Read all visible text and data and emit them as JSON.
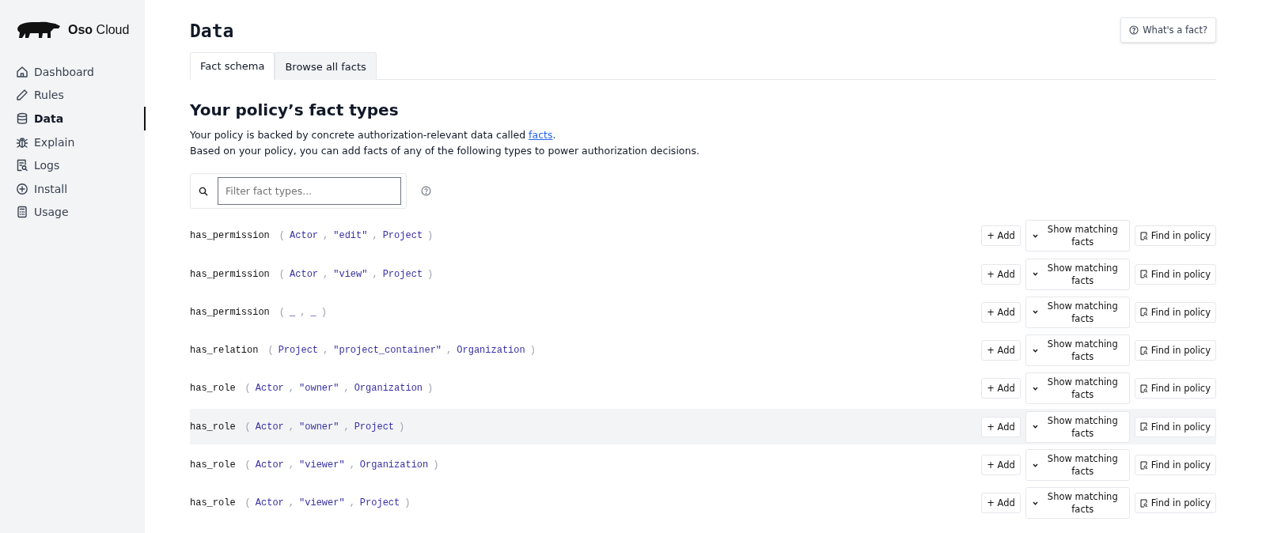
{
  "brand": {
    "name_bold": "Oso",
    "name_rest": "Cloud"
  },
  "sidebar": {
    "items": [
      {
        "label": "Dashboard",
        "selected": false
      },
      {
        "label": "Rules",
        "selected": false
      },
      {
        "label": "Data",
        "selected": true
      },
      {
        "label": "Explain",
        "selected": false
      },
      {
        "label": "Logs",
        "selected": false
      },
      {
        "label": "Install",
        "selected": false
      },
      {
        "label": "Usage",
        "selected": false
      }
    ]
  },
  "page": {
    "title": "Data",
    "help_button": "What's a fact?"
  },
  "tabs": [
    {
      "label": "Fact schema",
      "selected": true
    },
    {
      "label": "Browse all facts",
      "selected": false
    }
  ],
  "section": {
    "heading": "Your policy’s fact types",
    "intro_before_link": "Your policy is backed by concrete authorization-relevant data called",
    "intro_link": "facts",
    "intro_after_link": ".",
    "intro_line_2": "Based on your policy, you can add facts of any of the following types to power authorization decisions."
  },
  "filter": {
    "placeholder": "Filter fact types..."
  },
  "fact_types": [
    {
      "highlighted": false,
      "add": "+ Add",
      "show": "Show matching facts",
      "find": "Find in policy",
      "tokens": [
        {
          "kind": "name",
          "text": "has_permission"
        },
        {
          "kind": "punct",
          "text": "("
        },
        {
          "kind": "arg",
          "text": "Actor"
        },
        {
          "kind": "punct",
          "text": ","
        },
        {
          "kind": "arg",
          "text": "\"edit\""
        },
        {
          "kind": "punct",
          "text": ","
        },
        {
          "kind": "arg",
          "text": "Project"
        },
        {
          "kind": "punct",
          "text": ")"
        }
      ]
    },
    {
      "highlighted": false,
      "add": "+ Add",
      "show": "Show matching facts",
      "find": "Find in policy",
      "tokens": [
        {
          "kind": "name",
          "text": "has_permission"
        },
        {
          "kind": "punct",
          "text": "("
        },
        {
          "kind": "arg",
          "text": "Actor"
        },
        {
          "kind": "punct",
          "text": ","
        },
        {
          "kind": "arg",
          "text": "\"view\""
        },
        {
          "kind": "punct",
          "text": ","
        },
        {
          "kind": "arg",
          "text": "Project"
        },
        {
          "kind": "punct",
          "text": ")"
        }
      ]
    },
    {
      "highlighted": false,
      "add": "+ Add",
      "show": "Show matching facts",
      "find": "Find in policy",
      "tokens": [
        {
          "kind": "name",
          "text": "has_permission"
        },
        {
          "kind": "punct",
          "text": "("
        },
        {
          "kind": "arg",
          "text": "_"
        },
        {
          "kind": "punct",
          "text": ","
        },
        {
          "kind": "arg",
          "text": "_"
        },
        {
          "kind": "punct",
          "text": ")"
        }
      ]
    },
    {
      "highlighted": false,
      "add": "+ Add",
      "show": "Show matching facts",
      "find": "Find in policy",
      "tokens": [
        {
          "kind": "name",
          "text": "has_relation"
        },
        {
          "kind": "punct",
          "text": "("
        },
        {
          "kind": "arg",
          "text": "Project"
        },
        {
          "kind": "punct",
          "text": ","
        },
        {
          "kind": "arg",
          "text": "\"project_container\""
        },
        {
          "kind": "punct",
          "text": ","
        },
        {
          "kind": "arg",
          "text": "Organization"
        },
        {
          "kind": "punct",
          "text": ")"
        }
      ]
    },
    {
      "highlighted": false,
      "add": "+ Add",
      "show": "Show matching facts",
      "find": "Find in policy",
      "tokens": [
        {
          "kind": "name",
          "text": "has_role"
        },
        {
          "kind": "punct",
          "text": "("
        },
        {
          "kind": "arg",
          "text": "Actor"
        },
        {
          "kind": "punct",
          "text": ","
        },
        {
          "kind": "arg",
          "text": "\"owner\""
        },
        {
          "kind": "punct",
          "text": ","
        },
        {
          "kind": "arg",
          "text": "Organization"
        },
        {
          "kind": "punct",
          "text": ")"
        }
      ]
    },
    {
      "highlighted": true,
      "add": "+ Add",
      "show": "Show matching facts",
      "find": "Find in policy",
      "tokens": [
        {
          "kind": "name",
          "text": "has_role"
        },
        {
          "kind": "punct",
          "text": "("
        },
        {
          "kind": "arg",
          "text": "Actor"
        },
        {
          "kind": "punct",
          "text": ","
        },
        {
          "kind": "arg",
          "text": "\"owner\""
        },
        {
          "kind": "punct",
          "text": ","
        },
        {
          "kind": "arg",
          "text": "Project"
        },
        {
          "kind": "punct",
          "text": ")"
        }
      ]
    },
    {
      "highlighted": false,
      "add": "+ Add",
      "show": "Show matching facts",
      "find": "Find in policy",
      "tokens": [
        {
          "kind": "name",
          "text": "has_role"
        },
        {
          "kind": "punct",
          "text": "("
        },
        {
          "kind": "arg",
          "text": "Actor"
        },
        {
          "kind": "punct",
          "text": ","
        },
        {
          "kind": "arg",
          "text": "\"viewer\""
        },
        {
          "kind": "punct",
          "text": ","
        },
        {
          "kind": "arg",
          "text": "Organization"
        },
        {
          "kind": "punct",
          "text": ")"
        }
      ]
    },
    {
      "highlighted": false,
      "add": "+ Add",
      "show": "Show matching facts",
      "find": "Find in policy",
      "tokens": [
        {
          "kind": "name",
          "text": "has_role"
        },
        {
          "kind": "punct",
          "text": "("
        },
        {
          "kind": "arg",
          "text": "Actor"
        },
        {
          "kind": "punct",
          "text": ","
        },
        {
          "kind": "arg",
          "text": "\"viewer\""
        },
        {
          "kind": "punct",
          "text": ","
        },
        {
          "kind": "arg",
          "text": "Project"
        },
        {
          "kind": "punct",
          "text": ")"
        }
      ]
    }
  ]
}
